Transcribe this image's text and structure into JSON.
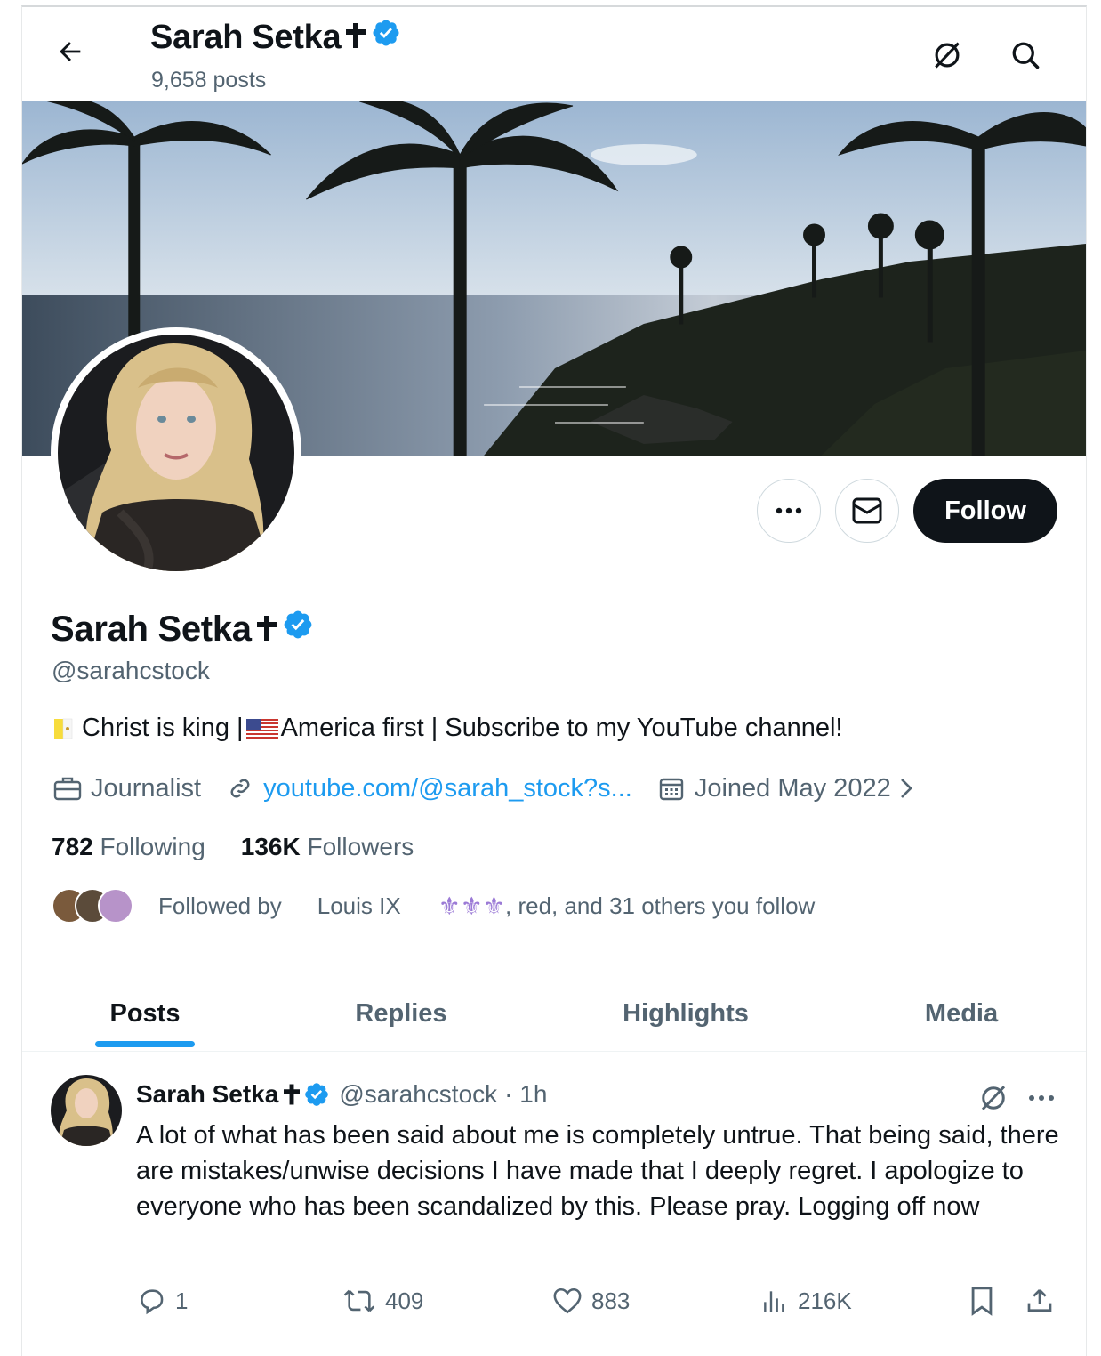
{
  "header": {
    "name": "Sarah Setka",
    "posts_count": "9,658 posts"
  },
  "profile": {
    "name": "Sarah Setka",
    "handle": "@sarahcstock",
    "bio_part1": "Christ is king |",
    "bio_part2": "America first | Subscribe to my YouTube channel!",
    "profession": "Journalist",
    "link": "youtube.com/@sarah_stock?s...",
    "joined": "Joined May 2022",
    "following_count": "782",
    "following_label": "Following",
    "followers_count": "136K",
    "followers_label": "Followers",
    "followed_by_label": "Followed by",
    "followed_by_first": "Louis IX",
    "followed_by_fleurs": "⚜⚜⚜",
    "followed_by_rest": ", red, and 31 others you follow"
  },
  "buttons": {
    "follow": "Follow"
  },
  "tabs": [
    {
      "label": "Posts",
      "active": true
    },
    {
      "label": "Replies",
      "active": false
    },
    {
      "label": "Highlights",
      "active": false
    },
    {
      "label": "Media",
      "active": false
    }
  ],
  "post": {
    "name": "Sarah Setka",
    "handle": "@sarahcstock",
    "time": "· 1h",
    "text": "A lot of what has been said about me is completely untrue. That being said, there are mistakes/unwise decisions I have made that I deeply regret. I apologize to everyone who has been scandalized by this. Please pray. Logging off now",
    "replies": "1",
    "reposts": "409",
    "likes": "883",
    "views": "216K"
  },
  "colors": {
    "accent": "#1d9bf0",
    "text": "#0f1419",
    "secondary": "#536471",
    "verified": "#1d9bf0"
  }
}
